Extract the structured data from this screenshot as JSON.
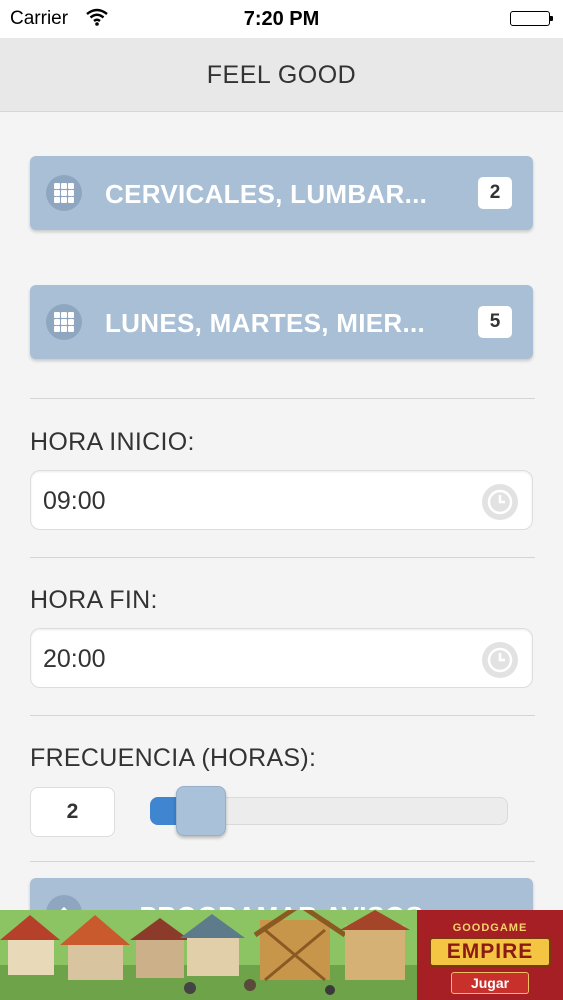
{
  "status_bar": {
    "carrier": "Carrier",
    "time": "7:20 PM",
    "wifi_icon": "wifi-icon",
    "battery_icon": "battery-icon"
  },
  "nav": {
    "title": "FEEL GOOD"
  },
  "zones_button": {
    "label": "CERVICALES, LUMBAR...",
    "count": "2",
    "icon": "grid-icon"
  },
  "days_button": {
    "label": "LUNES, MARTES, MIER...",
    "count": "5",
    "icon": "grid-icon"
  },
  "start_time": {
    "label": "HORA INICIO:",
    "value": "09:00",
    "icon": "clock-icon"
  },
  "end_time": {
    "label": "HORA FIN:",
    "value": "20:00",
    "icon": "clock-icon"
  },
  "frequency": {
    "label": "FRECUENCIA (HORAS):",
    "value": "2",
    "slider_fraction": 0.1
  },
  "program_button": {
    "label": "PROGRAMAR AVISOS",
    "icon": "chevron-up-icon"
  },
  "ad_banner": {
    "brand_top": "GOODGAME",
    "brand_name": "EMPIRE",
    "cta": "Jugar"
  },
  "colors": {
    "button_bg": "#a9bfd6",
    "slider_fill": "#3f85cf",
    "ad_red": "#a51f24"
  }
}
